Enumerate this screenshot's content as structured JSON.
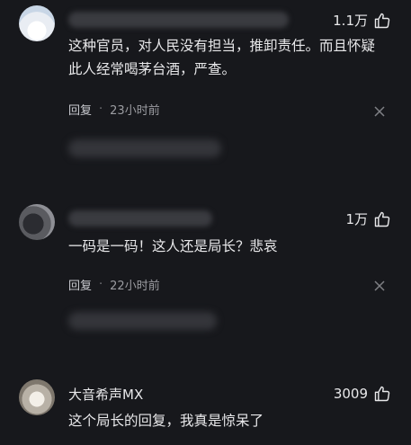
{
  "comments": [
    {
      "username": "",
      "likes": "1.1万",
      "text": "这种官员，对人民没有担当，推卸责任。而且怀疑此人经常喝茅台酒，严查。",
      "reply_label": "回复",
      "separator": "·",
      "time": "23小时前"
    },
    {
      "username": "",
      "likes": "1万",
      "text": "一码是一码！这人还是局长？悲哀",
      "reply_label": "回复",
      "separator": "·",
      "time": "22小时前"
    },
    {
      "username": "大音希声MX",
      "likes": "3009",
      "text": "这个局长的回复，我真是惊呆了"
    }
  ],
  "colors": {
    "background": "#17181c",
    "text": "#e8e8ea",
    "muted": "#9b9ca1"
  },
  "icons": [
    "thumbs-up-icon",
    "close-icon"
  ]
}
